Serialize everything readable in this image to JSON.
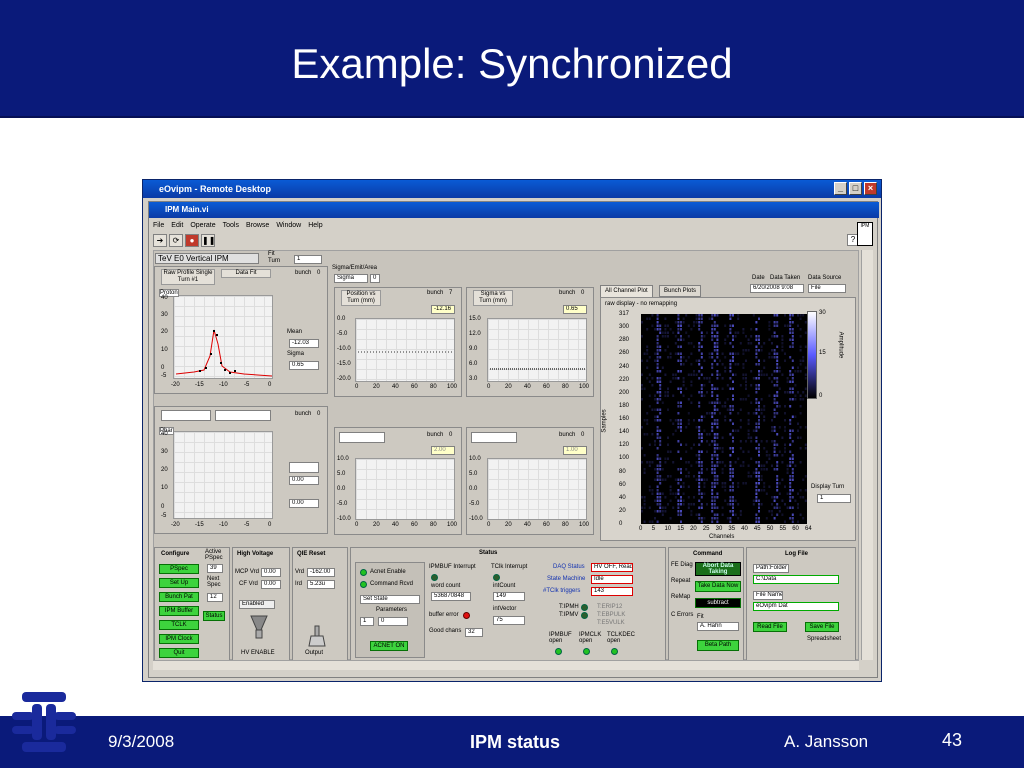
{
  "slide": {
    "title": "Example: Synchronized",
    "footer_date": "9/3/2008",
    "footer_center": "IPM status",
    "footer_author": "A. Jansson",
    "footer_page": "43"
  },
  "window": {
    "rd_title": "eOvipm - Remote Desktop",
    "vi_title": "IPM Main.vi",
    "menu": [
      "File",
      "Edit",
      "Operate",
      "Tools",
      "Browse",
      "Window",
      "Help"
    ]
  },
  "header": {
    "vi_name": "TeV E0 Vertical IPM",
    "fit_turn_label": "Fit Turn",
    "fit_turn_value": "1"
  },
  "proton": {
    "raw_profile_label": "Raw Profile Single Turn #1",
    "data_fit_label": "Data Fit",
    "bunch_label": "bunch",
    "bunch_value": "0",
    "plot_label": "Proton",
    "y_ticks": [
      "40",
      "30",
      "20",
      "10",
      "0",
      "-5"
    ],
    "x_ticks": [
      "-20",
      "-15",
      "-10",
      "-5",
      "0"
    ],
    "mean_label": "Mean",
    "mean_value": "-12.03",
    "sigma_label": "Sigma",
    "sigma_value": "0.65"
  },
  "pbar": {
    "bunch_label": "bunch",
    "bunch_value": "0",
    "plot_label": "Pbar",
    "y_ticks": [
      "40",
      "30",
      "20",
      "10",
      "0",
      "-5"
    ],
    "x_ticks": [
      "-20",
      "-15",
      "-10",
      "-5",
      "0"
    ],
    "val1": "0.00",
    "val2": "0.00"
  },
  "sigma_emit": {
    "label": "Sigma/Emit/Area",
    "select": "Sigma",
    "select_val": "0"
  },
  "pos_vs_turn": {
    "title": "Position vs Turn (mm)",
    "bunch_label": "bunch",
    "bunch_value": "7",
    "value": "-12.16",
    "y_ticks": [
      "0.0",
      "-5.0",
      "-10.0",
      "-15.0",
      "-20.0"
    ],
    "x_ticks": [
      "0",
      "20",
      "40",
      "60",
      "80",
      "100"
    ]
  },
  "sigma_vs_turn": {
    "title": "Sigma vs Turn (mm)",
    "bunch_label": "bunch",
    "bunch_value": "0",
    "value": "0.65",
    "y_ticks": [
      "15.0",
      "12.0",
      "9.0",
      "6.0",
      "3.0"
    ],
    "x_ticks": [
      "0",
      "20",
      "40",
      "60",
      "80",
      "100"
    ]
  },
  "lower_left_plot": {
    "bunch_label": "bunch",
    "bunch_value": "0",
    "value": "2.00",
    "y_ticks": [
      "10.0",
      "5.0",
      "0.0",
      "-5.0",
      "-10.0"
    ],
    "x_ticks": [
      "0",
      "20",
      "40",
      "60",
      "80",
      "100"
    ]
  },
  "lower_right_plot": {
    "bunch_label": "bunch",
    "bunch_value": "0",
    "value": "1.00",
    "y_ticks": [
      "10.0",
      "5.0",
      "0.0",
      "-5.0",
      "-10.0"
    ],
    "x_ticks": [
      "0",
      "20",
      "40",
      "60",
      "80",
      "100"
    ]
  },
  "channel_plot": {
    "tabs": [
      "All Channel Plot",
      "Bunch Plots"
    ],
    "raw_display": "raw display - no remapping",
    "date_label": "Date",
    "data_taken_label": "Data Taken",
    "date_value": "6/20/2008 9:08",
    "data_source_label": "Data Source",
    "data_source_value": "File",
    "y_axis_label": "Samples",
    "x_axis_label": "Channels",
    "y_ticks": [
      "317",
      "300",
      "280",
      "260",
      "240",
      "220",
      "200",
      "180",
      "160",
      "140",
      "120",
      "100",
      "80",
      "60",
      "40",
      "20",
      "0"
    ],
    "x_ticks": [
      "0",
      "5",
      "10",
      "15",
      "20",
      "25",
      "30",
      "35",
      "40",
      "45",
      "50",
      "55",
      "60",
      "64"
    ],
    "amplitude_label": "Amplitude",
    "cbar_ticks": [
      "30",
      "15",
      "0"
    ],
    "display_turn_label": "Display Turn",
    "display_turn_value": "1"
  },
  "configure": {
    "title": "Configure",
    "active_pspec_label": "Active PSpec",
    "active_pspec_value": "39",
    "next_spec_label": "Next Spec",
    "next_spec_value": "12",
    "buttons": [
      "PSpec",
      "Set Up",
      "Bunch Pat",
      "IPM Buffer",
      "TCLK",
      "IPM Clock",
      "Quit"
    ],
    "status_label": "Status"
  },
  "high_voltage": {
    "title": "High Voltage",
    "mcp_label": "MCP Vrd",
    "mcp_value": "0.00",
    "cf_label": "CF Vrd",
    "cf_value": "0.00",
    "enabled_label": "Enabled",
    "hv_enable_label": "HV ENABLE"
  },
  "qie_reset": {
    "title": "QIE Reset",
    "vrd_label": "Vrd",
    "vrd_value": "-162.00",
    "ird_label": "Ird",
    "ird_value": "5.23u",
    "output_label": "Output"
  },
  "status_box": {
    "title": "Status",
    "acnet_enable": "Acnet Enable",
    "command_rcvd": "Command Rcvd",
    "set_state": "Set State",
    "parameters": "Parameters",
    "param_index": "1",
    "param_value": "0",
    "acnet_on": "ACNET ON",
    "ipmbuf_interrupt": "IPMBUF Interrupt",
    "word_count_label": "word count",
    "word_count_value": "536870848",
    "buffer_error": "buffer error",
    "good_chans_label": "Good chans",
    "good_chans_value": "32",
    "tclk_interrupt": "TClk Interrupt",
    "int_count_label": "intCount",
    "int_count_value": "149",
    "int_vector_label": "intVector",
    "int_vector_value": "75",
    "daq_status_label": "DAQ Status",
    "daq_status_value": "HV OFF, Read",
    "state_machine_label": "State Machine",
    "state_machine_value": "Idle",
    "tclk_triggers_label": "#TClk triggers",
    "tclk_triggers_value": "143",
    "t_ipmh": "T:IPMH",
    "t_ipmv": "T:IPMV",
    "t_erip12": "T:ERIP12",
    "t_ebpulk": "T:EBPULK",
    "t_e5vulk": "T:E5VULK",
    "ipmbuf_open": "IPMBUF open",
    "ipmclk_open": "IPMCLK open",
    "tclkdec_open": "TCLKDEC open"
  },
  "command": {
    "title": "Command",
    "fe_diag": "FE Diag",
    "repeat": "Repeat",
    "remap": "ReMap",
    "c_errors": "C Errors",
    "abort_label": "Abort Data Taking",
    "take_data_label": "Take Data Now",
    "subtract_label": "subtract",
    "fit_label": "Fit",
    "fit_value": "A. Hahn",
    "beta_path_label": "Beta Path"
  },
  "log_file": {
    "title": "Log File",
    "path_folder_label": "Path:Folder",
    "path_value": "C:\\Data",
    "file_name_label": "File Name",
    "file_name_value": "eOvipm Dat",
    "read_file_label": "Read File",
    "save_file_label": "Save File",
    "spreadsheet_label": "Spreadsheet"
  }
}
